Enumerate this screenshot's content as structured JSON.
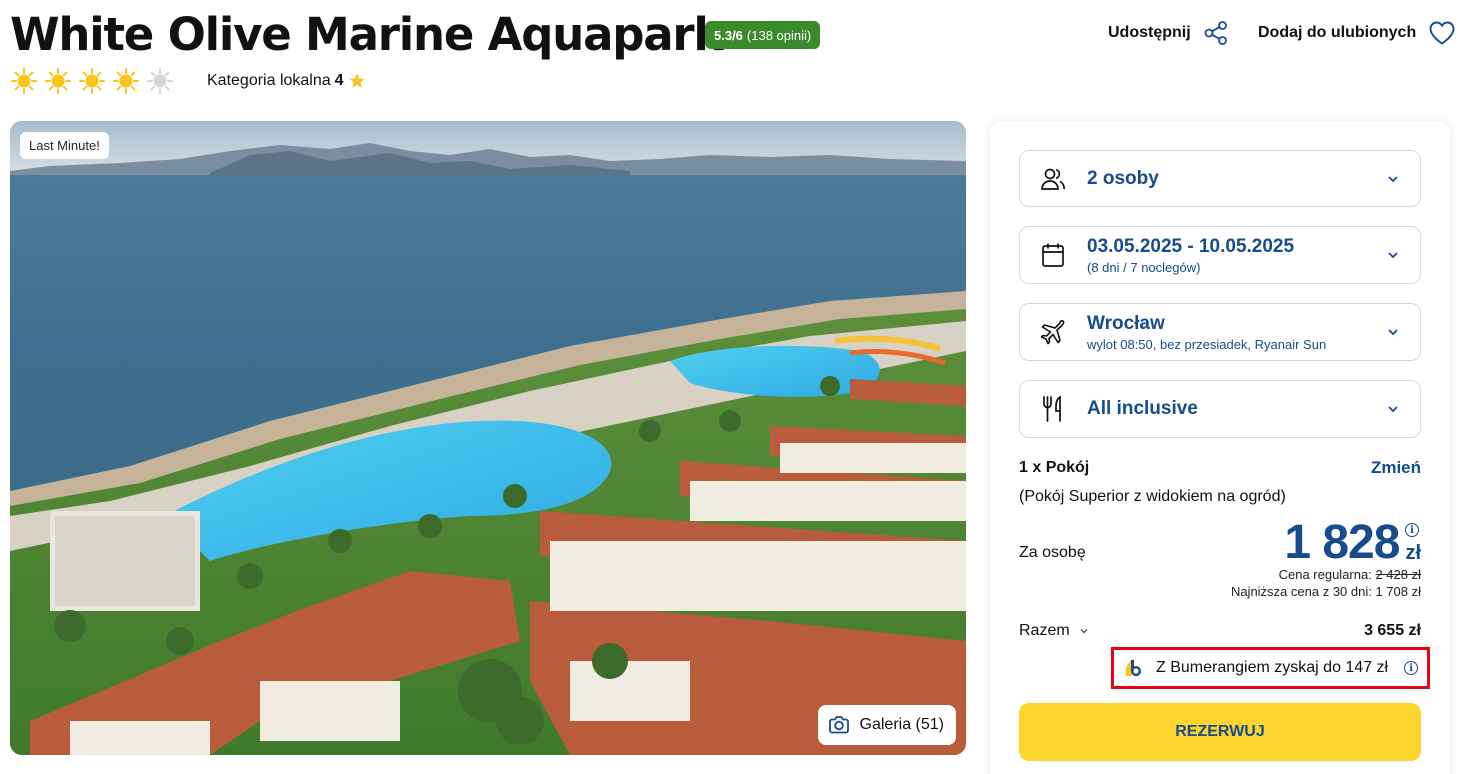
{
  "hotel": {
    "name": "White Olive Marine Aquapark",
    "rating_score": "5.3/6",
    "rating_reviews": "(138 opinii)",
    "suns_filled": 4,
    "suns_total": 5,
    "category_label": "Kategoria lokalna",
    "category_value": "4"
  },
  "actions": {
    "share_label": "Udostępnij",
    "favorite_label": "Dodaj do ulubionych"
  },
  "gallery": {
    "tag": "Last Minute!",
    "button_label": "Galeria (51)"
  },
  "booking": {
    "persons": "2 osoby",
    "dates": "03.05.2025 - 10.05.2025",
    "dates_sub": "(8 dni / 7 noclegów)",
    "departure": "Wrocław",
    "departure_sub": "wylot 08:50, bez przesiadek, Ryanair Sun",
    "board": "All inclusive",
    "room_count": "1 x Pokój",
    "change_label": "Zmień",
    "room_desc": "(Pokój Superior z widokiem na ogród)",
    "per_person_label": "Za osobę",
    "price": "1 828",
    "currency": "zł",
    "regular_label": "Cena regularna:",
    "regular_price": "2 428 zł",
    "lowest_label": "Najniższa cena z 30 dni: 1 708 zł",
    "total_label": "Razem",
    "total_value": "3 655 zł",
    "boomerang_text": "Z Bumerangiem zyskaj do 147 zł",
    "reserve_label": "REZERWUJ"
  },
  "colors": {
    "brand_blue": "#174b8d",
    "rating_green": "#3a8b2c",
    "sun_yellow": "#f9c41b",
    "reserve_yellow": "#fbd52e",
    "highlight_red": "#e30613"
  }
}
